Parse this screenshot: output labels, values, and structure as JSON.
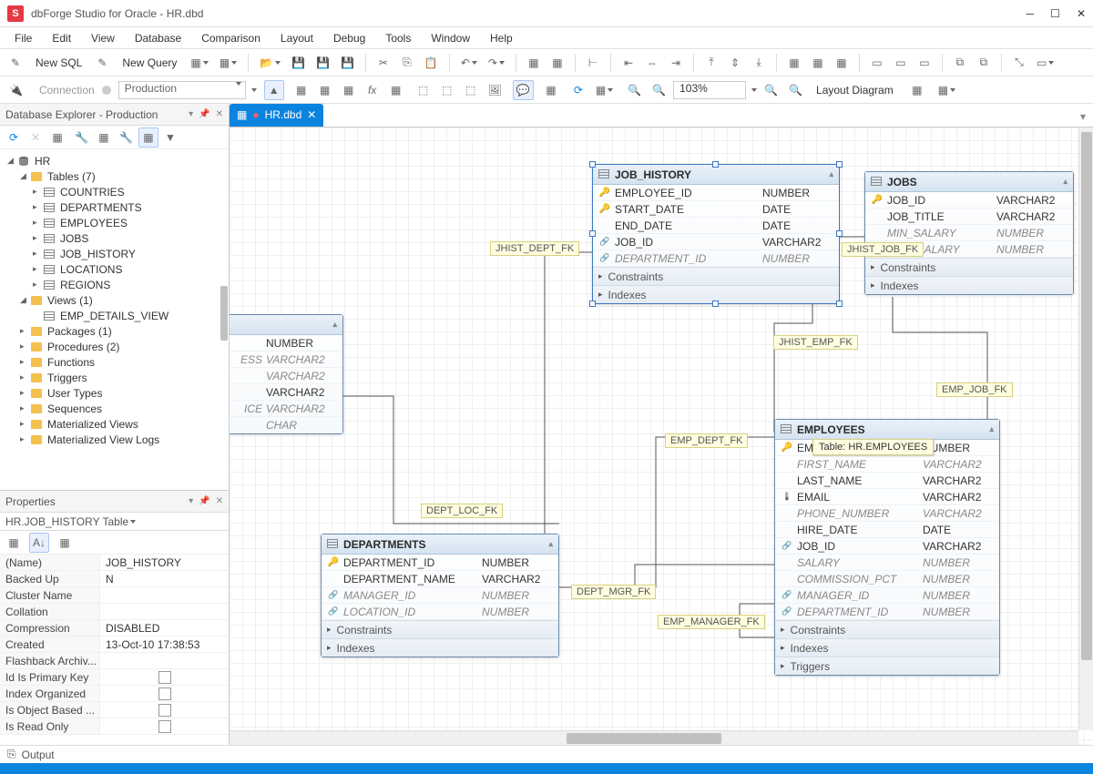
{
  "window": {
    "title": "dbForge Studio for Oracle - HR.dbd"
  },
  "menu": [
    "File",
    "Edit",
    "View",
    "Database",
    "Comparison",
    "Layout",
    "Debug",
    "Tools",
    "Window",
    "Help"
  ],
  "toolbar1": {
    "newSql": "New SQL",
    "newQuery": "New Query"
  },
  "toolbar2": {
    "connLabel": "Connection",
    "connValue": "Production",
    "zoom": "103%",
    "layoutBtn": "Layout Diagram"
  },
  "explorer": {
    "title": "Database Explorer - Production",
    "root": "HR",
    "tablesLabel": "Tables (7)",
    "tables": [
      "COUNTRIES",
      "DEPARTMENTS",
      "EMPLOYEES",
      "JOBS",
      "JOB_HISTORY",
      "LOCATIONS",
      "REGIONS"
    ],
    "viewsLabel": "Views (1)",
    "views": [
      "EMP_DETAILS_VIEW"
    ],
    "folders": [
      "Packages (1)",
      "Procedures (2)",
      "Functions",
      "Triggers",
      "User Types",
      "Sequences",
      "Materialized Views",
      "Materialized View Logs"
    ]
  },
  "properties": {
    "title": "Properties",
    "header": "HR.JOB_HISTORY   Table",
    "rows": [
      {
        "n": "(Name)",
        "v": "JOB_HISTORY"
      },
      {
        "n": "Backed Up",
        "v": "N"
      },
      {
        "n": "Cluster Name",
        "v": ""
      },
      {
        "n": "Collation",
        "v": ""
      },
      {
        "n": "Compression",
        "v": "DISABLED"
      },
      {
        "n": "Created",
        "v": "13-Oct-10 17:38:53"
      },
      {
        "n": "Flashback Archiv...",
        "v": ""
      },
      {
        "n": "Id Is Primary Key",
        "v": "[check]"
      },
      {
        "n": "Index Organized",
        "v": "[check]"
      },
      {
        "n": "Is Object Based ...",
        "v": "[check]"
      },
      {
        "n": "Is Read Only",
        "v": "[check]"
      }
    ]
  },
  "tab": {
    "name": "HR.dbd"
  },
  "fkLabels": {
    "jhist_dept": "JHIST_DEPT_FK",
    "jhist_job": "JHIST_JOB_FK",
    "jhist_emp": "JHIST_EMP_FK",
    "emp_job": "EMP_JOB_FK",
    "emp_dept": "EMP_DEPT_FK",
    "dept_mgr": "DEPT_MGR_FK",
    "dept_loc": "DEPT_LOC_FK",
    "emp_manager": "EMP_MANAGER_FK"
  },
  "tooltip": "Table: HR.EMPLOYEES",
  "entities": {
    "jobHistory": {
      "name": "JOB_HISTORY",
      "cols": [
        {
          "n": "EMPLOYEE_ID",
          "t": "NUMBER",
          "k": "pk"
        },
        {
          "n": "START_DATE",
          "t": "DATE",
          "k": "pk"
        },
        {
          "n": "END_DATE",
          "t": "DATE",
          "k": ""
        },
        {
          "n": "JOB_ID",
          "t": "VARCHAR2",
          "k": "fk"
        },
        {
          "n": "DEPARTMENT_ID",
          "t": "NUMBER",
          "k": "fk",
          "i": true
        }
      ],
      "secs": [
        "Constraints",
        "Indexes"
      ]
    },
    "jobs": {
      "name": "JOBS",
      "cols": [
        {
          "n": "JOB_ID",
          "t": "VARCHAR2",
          "k": "pk"
        },
        {
          "n": "JOB_TITLE",
          "t": "VARCHAR2",
          "k": ""
        },
        {
          "n": "MIN_SALARY",
          "t": "NUMBER",
          "k": "",
          "i": true
        },
        {
          "n": "MAX_SALARY",
          "t": "NUMBER",
          "k": "",
          "i": true
        }
      ],
      "secs": [
        "Constraints",
        "Indexes"
      ]
    },
    "employees": {
      "name": "EMPLOYEES",
      "cols": [
        {
          "n": "EMPLOYEE_ID",
          "t": "NUMBER",
          "k": "pk"
        },
        {
          "n": "FIRST_NAME",
          "t": "VARCHAR2",
          "k": "",
          "i": true
        },
        {
          "n": "LAST_NAME",
          "t": "VARCHAR2",
          "k": ""
        },
        {
          "n": "EMAIL",
          "t": "VARCHAR2",
          "k": "uq"
        },
        {
          "n": "PHONE_NUMBER",
          "t": "VARCHAR2",
          "k": "",
          "i": true
        },
        {
          "n": "HIRE_DATE",
          "t": "DATE",
          "k": ""
        },
        {
          "n": "JOB_ID",
          "t": "VARCHAR2",
          "k": "fk"
        },
        {
          "n": "SALARY",
          "t": "NUMBER",
          "k": "",
          "i": true
        },
        {
          "n": "COMMISSION_PCT",
          "t": "NUMBER",
          "k": "",
          "i": true
        },
        {
          "n": "MANAGER_ID",
          "t": "NUMBER",
          "k": "fk",
          "i": true
        },
        {
          "n": "DEPARTMENT_ID",
          "t": "NUMBER",
          "k": "fk",
          "i": true
        }
      ],
      "secs": [
        "Constraints",
        "Indexes",
        "Triggers"
      ]
    },
    "departments": {
      "name": "DEPARTMENTS",
      "cols": [
        {
          "n": "DEPARTMENT_ID",
          "t": "NUMBER",
          "k": "pk"
        },
        {
          "n": "DEPARTMENT_NAME",
          "t": "VARCHAR2",
          "k": ""
        },
        {
          "n": "MANAGER_ID",
          "t": "NUMBER",
          "k": "fk",
          "i": true
        },
        {
          "n": "LOCATION_ID",
          "t": "NUMBER",
          "k": "fk",
          "i": true
        }
      ],
      "secs": [
        "Constraints",
        "Indexes"
      ]
    },
    "partial": {
      "cols": [
        {
          "n": "",
          "t": "NUMBER"
        },
        {
          "n": "ESS",
          "t": "VARCHAR2",
          "i": true
        },
        {
          "n": "",
          "t": "VARCHAR2",
          "i": true
        },
        {
          "n": "",
          "t": "VARCHAR2"
        },
        {
          "n": "ICE",
          "t": "VARCHAR2",
          "i": true
        },
        {
          "n": "",
          "t": "CHAR",
          "i": true
        }
      ]
    }
  },
  "status": {
    "output": "Output"
  }
}
